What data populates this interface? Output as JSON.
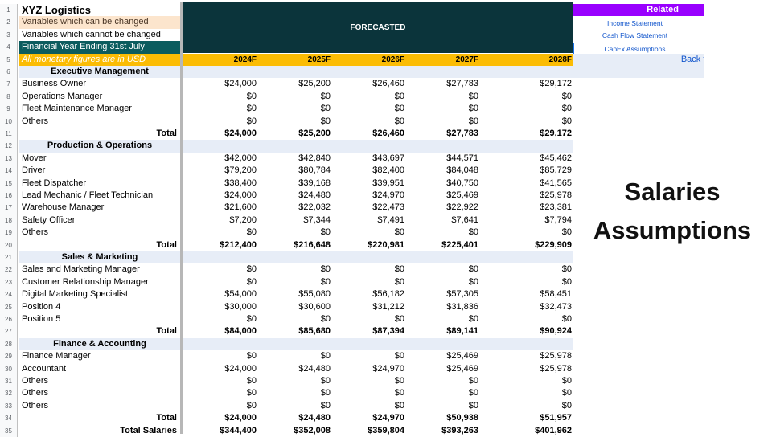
{
  "company": "XYZ Logistics",
  "legend": {
    "changeable": "Variables which can be changed",
    "unchangeable": "Variables which cannot be changed",
    "fiscal_year": "Financial Year Ending 31st July",
    "currency_note": "All monetary figures are in USD"
  },
  "forecast_label": "FORECASTED",
  "years": [
    "2024F",
    "2025F",
    "2026F",
    "2027F",
    "2028F"
  ],
  "related": {
    "title": "Related",
    "links": [
      "Income Statement",
      "Cash Flow Statement",
      "CapEx Assumptions"
    ],
    "back": "Back to Table of Contents"
  },
  "side_title": "Salaries Assumptions",
  "rows": [
    {
      "n": "6",
      "type": "section",
      "label": "Executive Management"
    },
    {
      "n": "7",
      "type": "item",
      "label": "Business Owner",
      "values": [
        "$24,000",
        "$25,200",
        "$26,460",
        "$27,783",
        "$29,172"
      ]
    },
    {
      "n": "8",
      "type": "item",
      "label": "Operations Manager",
      "values": [
        "$0",
        "$0",
        "$0",
        "$0",
        "$0"
      ]
    },
    {
      "n": "9",
      "type": "item",
      "label": "Fleet Maintenance Manager",
      "values": [
        "$0",
        "$0",
        "$0",
        "$0",
        "$0"
      ]
    },
    {
      "n": "10",
      "type": "item",
      "label": "Others",
      "values": [
        "$0",
        "$0",
        "$0",
        "$0",
        "$0"
      ]
    },
    {
      "n": "11",
      "type": "total",
      "label": "Total",
      "values": [
        "$24,000",
        "$25,200",
        "$26,460",
        "$27,783",
        "$29,172"
      ]
    },
    {
      "n": "12",
      "type": "section",
      "label": "Production & Operations"
    },
    {
      "n": "13",
      "type": "item",
      "label": "Mover",
      "values": [
        "$42,000",
        "$42,840",
        "$43,697",
        "$44,571",
        "$45,462"
      ]
    },
    {
      "n": "14",
      "type": "item",
      "label": "Driver",
      "values": [
        "$79,200",
        "$80,784",
        "$82,400",
        "$84,048",
        "$85,729"
      ]
    },
    {
      "n": "15",
      "type": "item",
      "label": "Fleet Dispatcher",
      "values": [
        "$38,400",
        "$39,168",
        "$39,951",
        "$40,750",
        "$41,565"
      ]
    },
    {
      "n": "16",
      "type": "item",
      "label": "Lead Mechanic / Fleet Technician",
      "values": [
        "$24,000",
        "$24,480",
        "$24,970",
        "$25,469",
        "$25,978"
      ]
    },
    {
      "n": "17",
      "type": "item",
      "label": "Warehouse Manager",
      "values": [
        "$21,600",
        "$22,032",
        "$22,473",
        "$22,922",
        "$23,381"
      ]
    },
    {
      "n": "18",
      "type": "item",
      "label": "Safety Officer",
      "values": [
        "$7,200",
        "$7,344",
        "$7,491",
        "$7,641",
        "$7,794"
      ]
    },
    {
      "n": "19",
      "type": "item",
      "label": "Others",
      "values": [
        "$0",
        "$0",
        "$0",
        "$0",
        "$0"
      ]
    },
    {
      "n": "20",
      "type": "total",
      "label": "Total",
      "values": [
        "$212,400",
        "$216,648",
        "$220,981",
        "$225,401",
        "$229,909"
      ]
    },
    {
      "n": "21",
      "type": "section",
      "label": "Sales & Marketing"
    },
    {
      "n": "22",
      "type": "item",
      "label": "Sales and Marketing Manager",
      "values": [
        "$0",
        "$0",
        "$0",
        "$0",
        "$0"
      ]
    },
    {
      "n": "23",
      "type": "item",
      "label": "Customer Relationship Manager",
      "values": [
        "$0",
        "$0",
        "$0",
        "$0",
        "$0"
      ]
    },
    {
      "n": "24",
      "type": "item",
      "label": "Digital Marketing Specialist",
      "values": [
        "$54,000",
        "$55,080",
        "$56,182",
        "$57,305",
        "$58,451"
      ]
    },
    {
      "n": "25",
      "type": "item",
      "label": "Position 4",
      "values": [
        "$30,000",
        "$30,600",
        "$31,212",
        "$31,836",
        "$32,473"
      ]
    },
    {
      "n": "26",
      "type": "item",
      "label": "Position 5",
      "values": [
        "$0",
        "$0",
        "$0",
        "$0",
        "$0"
      ]
    },
    {
      "n": "27",
      "type": "total",
      "label": "Total",
      "values": [
        "$84,000",
        "$85,680",
        "$87,394",
        "$89,141",
        "$90,924"
      ]
    },
    {
      "n": "28",
      "type": "section",
      "label": "Finance & Accounting"
    },
    {
      "n": "29",
      "type": "item",
      "label": "Finance Manager",
      "values": [
        "$0",
        "$0",
        "$0",
        "$25,469",
        "$25,978"
      ]
    },
    {
      "n": "30",
      "type": "item",
      "label": "Accountant",
      "values": [
        "$24,000",
        "$24,480",
        "$24,970",
        "$25,469",
        "$25,978"
      ]
    },
    {
      "n": "31",
      "type": "item",
      "label": "Others",
      "values": [
        "$0",
        "$0",
        "$0",
        "$0",
        "$0"
      ]
    },
    {
      "n": "32",
      "type": "item",
      "label": "Others",
      "values": [
        "$0",
        "$0",
        "$0",
        "$0",
        "$0"
      ]
    },
    {
      "n": "33",
      "type": "item",
      "label": "Others",
      "values": [
        "$0",
        "$0",
        "$0",
        "$0",
        "$0"
      ]
    },
    {
      "n": "34",
      "type": "total",
      "label": "Total",
      "values": [
        "$24,000",
        "$24,480",
        "$24,970",
        "$50,938",
        "$51,957"
      ]
    },
    {
      "n": "35",
      "type": "total",
      "label": "Total Salaries",
      "values": [
        "$344,400",
        "$352,008",
        "$359,804",
        "$393,263",
        "$401,962"
      ]
    }
  ]
}
